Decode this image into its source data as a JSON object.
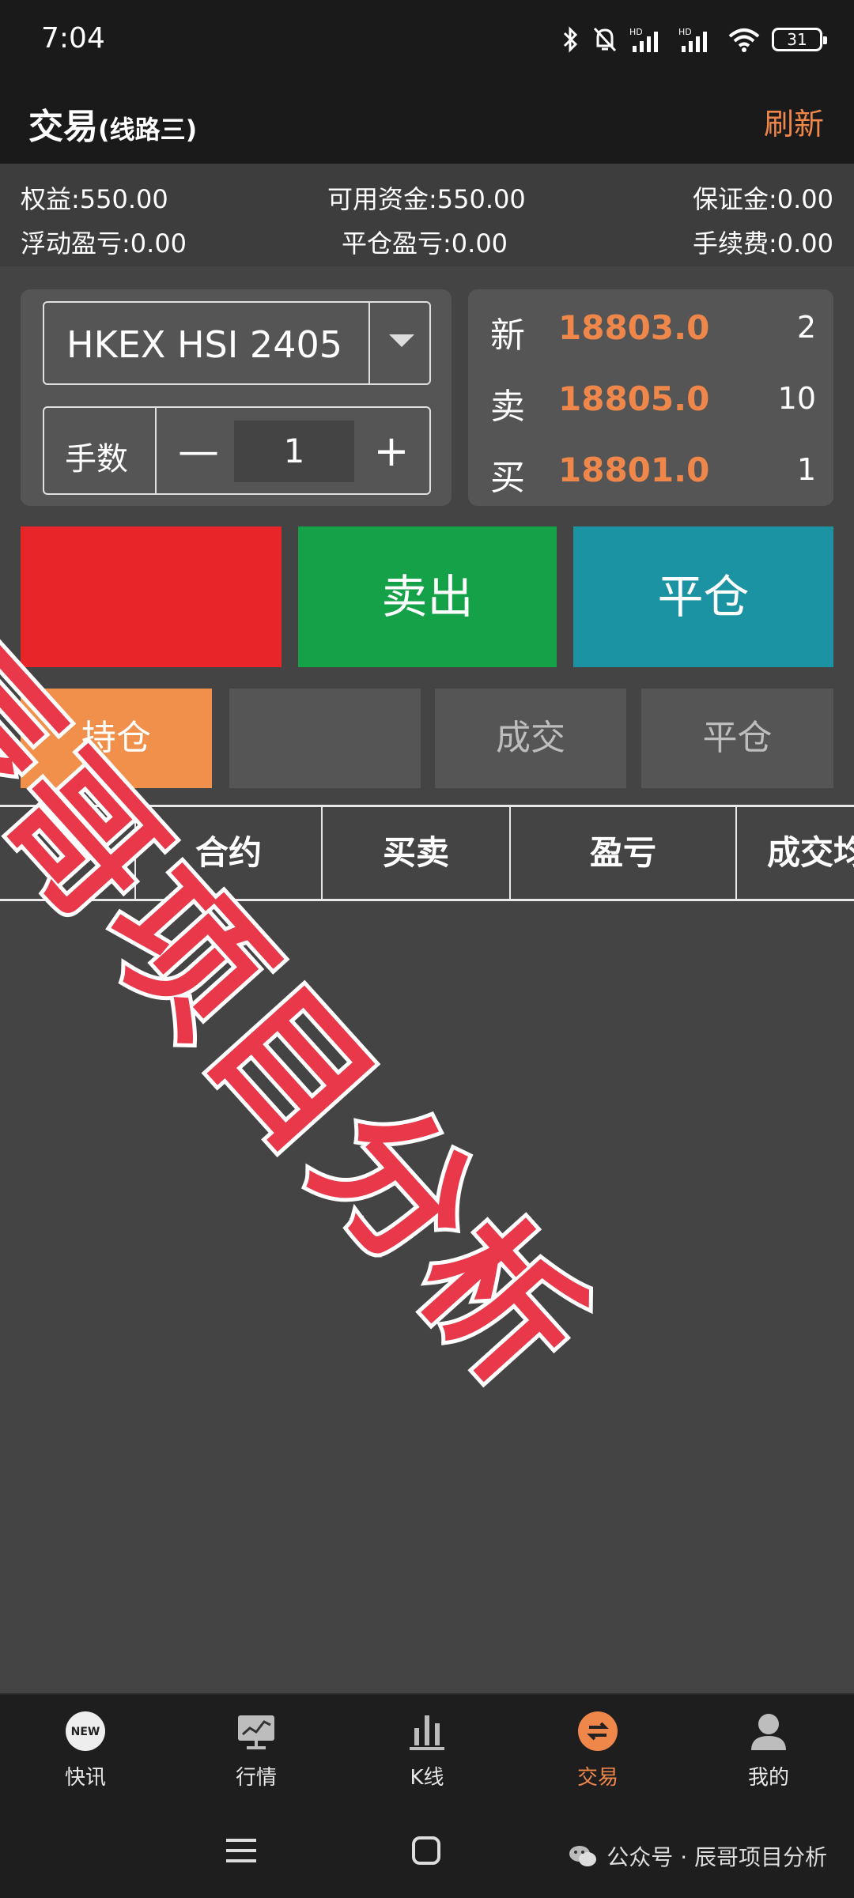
{
  "status_bar": {
    "time": "7:04",
    "battery": "31",
    "icons": [
      "bluetooth-icon",
      "bell-off-icon",
      "hd-signal-icon",
      "hd-signal-icon",
      "wifi-icon",
      "battery-icon"
    ]
  },
  "header": {
    "title": "交易",
    "subtitle": "(线路三)",
    "refresh_label": "刷新"
  },
  "account": {
    "equity": "权益:550.00",
    "available": "可用资金:550.00",
    "margin": "保证金:0.00",
    "floating_pl": "浮动盈亏:0.00",
    "closed_pl": "平仓盈亏:0.00",
    "fee": "手续费:0.00"
  },
  "order": {
    "symbol": "HKEX HSI 2405",
    "lots_label": "手数",
    "lots_value": "1",
    "minus": "—",
    "plus": "+"
  },
  "quote": {
    "rows": [
      {
        "label": "新",
        "price": "18803.0",
        "volume": "2"
      },
      {
        "label": "卖",
        "price": "18805.0",
        "volume": "10"
      },
      {
        "label": "买",
        "price": "18801.0",
        "volume": "1"
      }
    ]
  },
  "trade_buttons": {
    "buy": "",
    "sell": "卖出",
    "close": "平仓"
  },
  "tabs": [
    {
      "label": "持仓",
      "active": true
    },
    {
      "label": ""
    },
    {
      "label": "成交"
    },
    {
      "label": "平仓"
    }
  ],
  "table": {
    "headers": [
      "",
      "合约",
      "买卖",
      "盈亏",
      "成交均价"
    ]
  },
  "bottom_nav": [
    {
      "label": "快讯",
      "icon": "new-badge-icon"
    },
    {
      "label": "行情",
      "icon": "chart-board-icon"
    },
    {
      "label": "K线",
      "icon": "bar-chart-icon"
    },
    {
      "label": "交易",
      "icon": "exchange-icon",
      "active": true
    },
    {
      "label": "我的",
      "icon": "user-icon"
    }
  ],
  "watermark_text": "辰哥项目分析",
  "footer": {
    "wechat_text": "公众号 · 辰哥项目分析"
  },
  "colors": {
    "accent": "#f0874a",
    "buy": "#e8262a",
    "sell": "#15a148",
    "close": "#1b93a2",
    "tab_active": "#f0904a",
    "watermark": "#e8384a"
  }
}
